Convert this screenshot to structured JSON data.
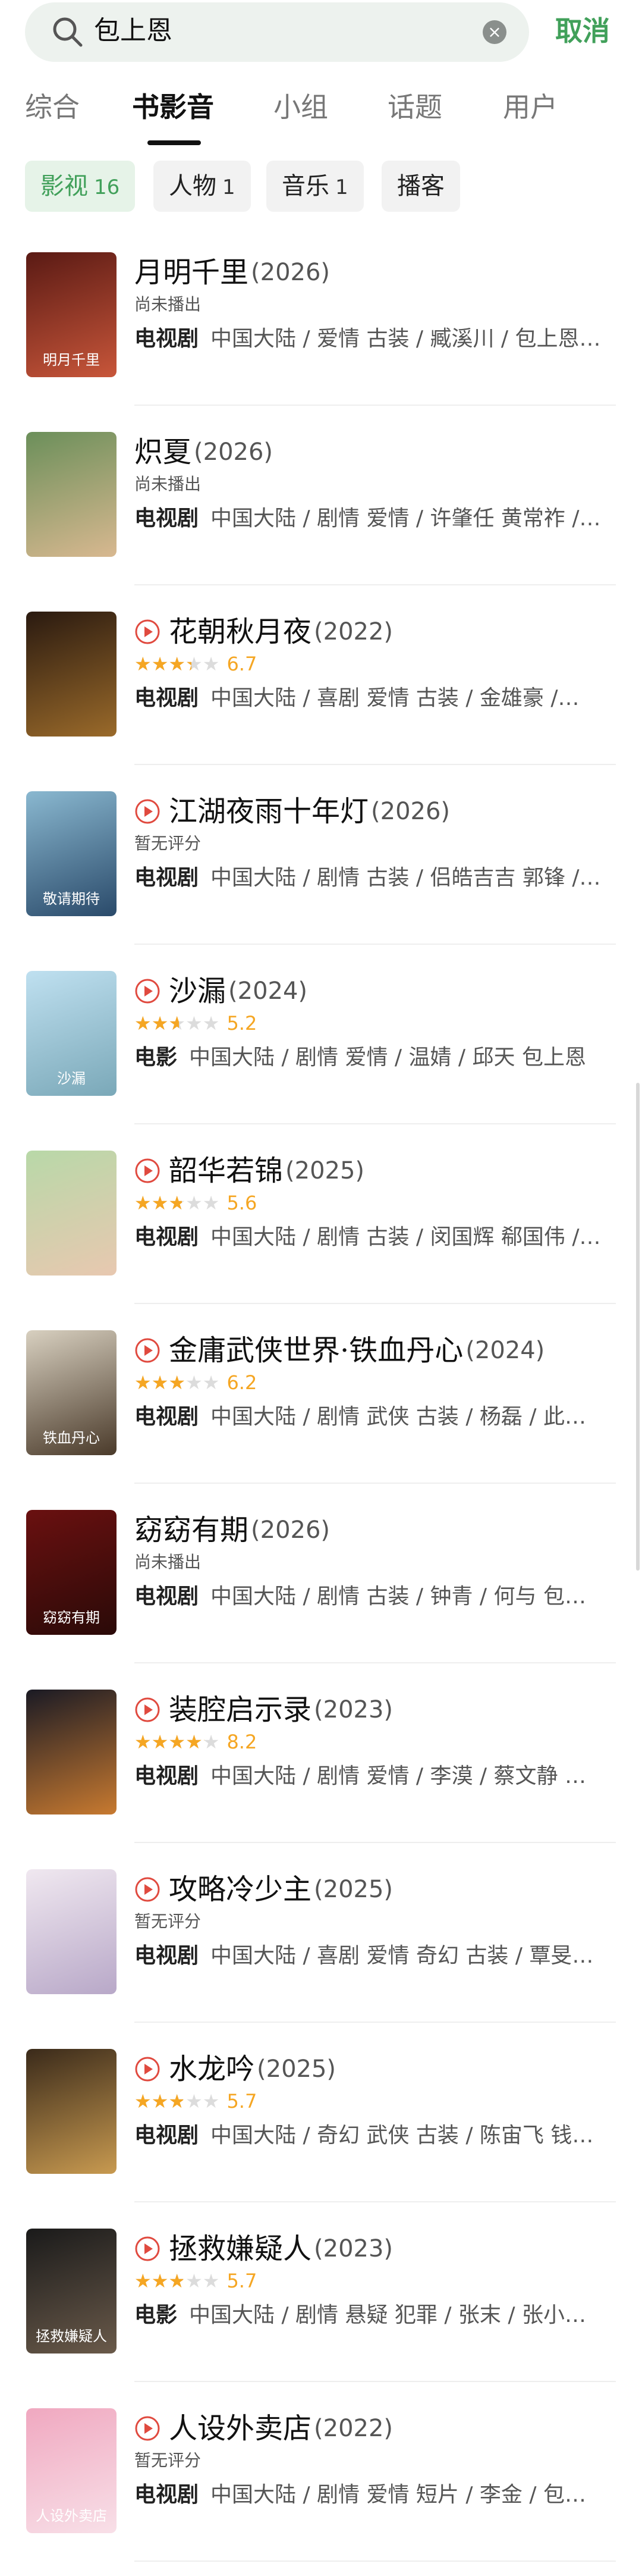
{
  "search": {
    "query": "包上恩",
    "cancel_label": "取消"
  },
  "tabs": [
    {
      "label": "综合"
    },
    {
      "label": "书影音"
    },
    {
      "label": "小组"
    },
    {
      "label": "话题"
    },
    {
      "label": "用户"
    }
  ],
  "active_tab": "书影音",
  "filters": [
    {
      "label": "影视",
      "count": "16",
      "active": true
    },
    {
      "label": "人物",
      "count": "1"
    },
    {
      "label": "音乐",
      "count": "1"
    },
    {
      "label": "播客",
      "count": ""
    }
  ],
  "colors": {
    "accent": "#41a05a",
    "star": "#f5a623",
    "play": "#e04a3f"
  },
  "results": [
    {
      "title": "月明千里",
      "year": "(2026)",
      "playable": false,
      "status": "尚未播出",
      "rating": null,
      "score": "",
      "type": "电视剧",
      "meta": "中国大陆 / 爱情 古装 / 臧溪川 / 包上恩…",
      "poster_text": "明月千里",
      "poster_colors": [
        "#5a1a14",
        "#c8563a"
      ]
    },
    {
      "title": "炽夏",
      "year": "(2026)",
      "playable": false,
      "status": "尚未播出",
      "rating": null,
      "score": "",
      "type": "电视剧",
      "meta": "中国大陆 / 剧情 爱情 / 许肇任 黄常祚 /…",
      "poster_text": "",
      "poster_colors": [
        "#6b8f5a",
        "#d8b890"
      ]
    },
    {
      "title": "花朝秋月夜",
      "year": "(2022)",
      "playable": true,
      "status": "",
      "rating": 3.35,
      "score": "6.7",
      "type": "电视剧",
      "meta": "中国大陆 / 喜剧 爱情 古装 / 金雄豪 /…",
      "poster_text": "",
      "poster_colors": [
        "#2a1a10",
        "#9a6a2a"
      ]
    },
    {
      "title": "江湖夜雨十年灯",
      "year": "(2026)",
      "playable": true,
      "status": "暂无评分",
      "rating": null,
      "score": "",
      "type": "电视剧",
      "meta": "中国大陆 / 剧情 古装 / 侣皓吉吉 郭锋 /…",
      "poster_text": "敬请期待",
      "poster_colors": [
        "#8ab8d0",
        "#2a4a6a"
      ]
    },
    {
      "title": "沙漏",
      "year": "(2024)",
      "playable": true,
      "status": "",
      "rating": 2.6,
      "score": "5.2",
      "type": "电影",
      "meta": "中国大陆 / 剧情 爱情 / 温婧 / 邱天 包上恩",
      "poster_text": "沙漏",
      "poster_colors": [
        "#bfe0f0",
        "#7aa8b8"
      ]
    },
    {
      "title": "韶华若锦",
      "year": "(2025)",
      "playable": true,
      "status": "",
      "rating": 2.8,
      "score": "5.6",
      "type": "电视剧",
      "meta": "中国大陆 / 剧情 古装 / 闵国辉 郗国伟 /…",
      "poster_text": "",
      "poster_colors": [
        "#b8d8a8",
        "#e8c8b0"
      ]
    },
    {
      "title": "金庸武侠世界·铁血丹心",
      "year": "(2024)",
      "playable": true,
      "status": "",
      "rating": 3.1,
      "score": "6.2",
      "type": "电视剧",
      "meta": "中国大陆 / 剧情 武侠 古装 / 杨磊 / 此…",
      "poster_text": "铁血丹心",
      "poster_colors": [
        "#d8d0c0",
        "#4a3a2a"
      ]
    },
    {
      "title": "窈窈有期",
      "year": "(2026)",
      "playable": false,
      "status": "尚未播出",
      "rating": null,
      "score": "",
      "type": "电视剧",
      "meta": "中国大陆 / 剧情 古装 / 钟青 / 何与 包…",
      "poster_text": "窈窈有期",
      "poster_colors": [
        "#6a1010",
        "#2a0a08"
      ]
    },
    {
      "title": "装腔启示录",
      "year": "(2023)",
      "playable": true,
      "status": "",
      "rating": 4.1,
      "score": "8.2",
      "type": "电视剧",
      "meta": "中国大陆 / 剧情 爱情 / 李漠 / 蔡文静 …",
      "poster_text": "",
      "poster_colors": [
        "#1a1a24",
        "#c87a30"
      ]
    },
    {
      "title": "攻略冷少主",
      "year": "(2025)",
      "playable": true,
      "status": "暂无评分",
      "rating": null,
      "score": "",
      "type": "电视剧",
      "meta": "中国大陆 / 喜剧 爱情 奇幻 古装 / 覃旻…",
      "poster_text": "",
      "poster_colors": [
        "#f0e8f0",
        "#b8a8c8"
      ]
    },
    {
      "title": "水龙吟",
      "year": "(2025)",
      "playable": true,
      "status": "",
      "rating": 2.85,
      "score": "5.7",
      "type": "电视剧",
      "meta": "中国大陆 / 奇幻 武侠 古装 / 陈宙飞 钱…",
      "poster_text": "",
      "poster_colors": [
        "#3a2a1a",
        "#c89a50"
      ]
    },
    {
      "title": "拯救嫌疑人",
      "year": "(2023)",
      "playable": true,
      "status": "",
      "rating": 2.85,
      "score": "5.7",
      "type": "电影",
      "meta": "中国大陆 / 剧情 悬疑 犯罪 / 张末 / 张小…",
      "poster_text": "拯救嫌疑人",
      "poster_colors": [
        "#1a1a1a",
        "#6a5a4a"
      ]
    },
    {
      "title": "人设外卖店",
      "year": "(2022)",
      "playable": true,
      "status": "暂无评分",
      "rating": null,
      "score": "",
      "type": "电视剧",
      "meta": "中国大陆 / 剧情 爱情 短片 / 李金 / 包…",
      "poster_text": "人设外卖店",
      "poster_colors": [
        "#f0a8c0",
        "#f8e0e8"
      ]
    }
  ]
}
